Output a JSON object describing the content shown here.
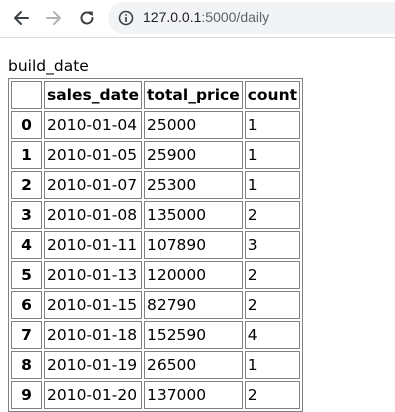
{
  "browser": {
    "url_host": "127.0.0.1",
    "url_path": ":5000/daily"
  },
  "page": {
    "title": "build_date",
    "columns": [
      "",
      "sales_date",
      "total_price",
      "count"
    ],
    "rows": [
      {
        "index": "0",
        "sales_date": "2010-01-04",
        "total_price": "25000",
        "count": "1"
      },
      {
        "index": "1",
        "sales_date": "2010-01-05",
        "total_price": "25900",
        "count": "1"
      },
      {
        "index": "2",
        "sales_date": "2010-01-07",
        "total_price": "25300",
        "count": "1"
      },
      {
        "index": "3",
        "sales_date": "2010-01-08",
        "total_price": "135000",
        "count": "2"
      },
      {
        "index": "4",
        "sales_date": "2010-01-11",
        "total_price": "107890",
        "count": "3"
      },
      {
        "index": "5",
        "sales_date": "2010-01-13",
        "total_price": "120000",
        "count": "2"
      },
      {
        "index": "6",
        "sales_date": "2010-01-15",
        "total_price": "82790",
        "count": "2"
      },
      {
        "index": "7",
        "sales_date": "2010-01-18",
        "total_price": "152590",
        "count": "4"
      },
      {
        "index": "8",
        "sales_date": "2010-01-19",
        "total_price": "26500",
        "count": "1"
      },
      {
        "index": "9",
        "sales_date": "2010-01-20",
        "total_price": "137000",
        "count": "2"
      }
    ]
  },
  "icons": {
    "back": "back-arrow-icon",
    "forward": "forward-arrow-icon",
    "reload": "reload-icon",
    "info": "info-icon"
  }
}
